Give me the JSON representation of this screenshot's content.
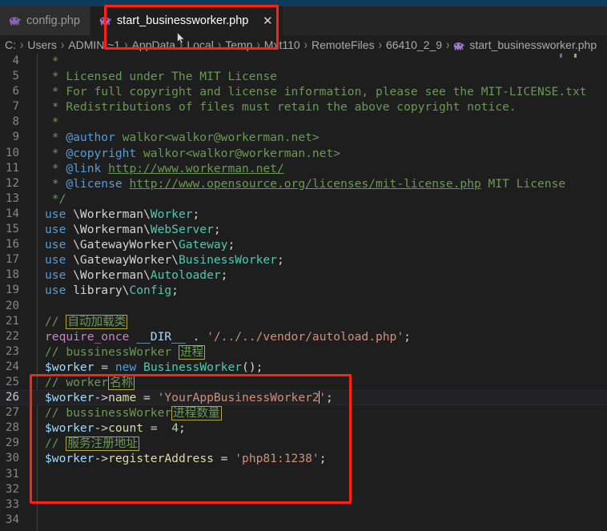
{
  "window": {
    "title_strip_color": "#0c3b5e"
  },
  "tabs": {
    "items": [
      {
        "label": "config.php",
        "icon": "php-elephant-icon",
        "active": false,
        "closable": false
      },
      {
        "label": "start_businessworker.php",
        "icon": "php-elephant-icon",
        "active": true,
        "closable": true,
        "close_label": "✕"
      }
    ]
  },
  "breadcrumbs": {
    "items": [
      {
        "label": "C:",
        "icon": null
      },
      {
        "label": "Users",
        "icon": null
      },
      {
        "label": "ADMINI~1",
        "icon": null
      },
      {
        "label": "AppData",
        "icon": null
      },
      {
        "label": "Local",
        "icon": null
      },
      {
        "label": "Temp",
        "icon": null
      },
      {
        "label": "Mxt110",
        "icon": null
      },
      {
        "label": "RemoteFiles",
        "icon": null
      },
      {
        "label": "66410_2_9",
        "icon": null
      },
      {
        "label": "start_businessworker.php",
        "icon": "php-elephant-icon"
      }
    ],
    "separator": "›"
  },
  "editor": {
    "language": "php",
    "current_line": 26,
    "first_visible_line": 4,
    "last_visible_line": 34,
    "colors": {
      "background": "#1e1e1e",
      "comment": "#6a9955",
      "keyword": "#569cd6",
      "type": "#4ec9b0",
      "string": "#ce9178",
      "variable": "#9cdcfe",
      "property": "#dcdcaa",
      "number": "#b5cea8",
      "function": "#c586c0",
      "linenumber": "#868686",
      "cjk_box_border": "#b5a642"
    },
    "lines": [
      {
        "n": 4,
        "text": " *"
      },
      {
        "n": 5,
        "text": " * Licensed under The MIT License"
      },
      {
        "n": 6,
        "text": " * For full copyright and license information, please see the MIT-LICENSE.txt"
      },
      {
        "n": 7,
        "text": " * Redistributions of files must retain the above copyright notice."
      },
      {
        "n": 8,
        "text": " *"
      },
      {
        "n": 9,
        "text": " * @author walkor<walkor@workerman.net>"
      },
      {
        "n": 10,
        "text": " * @copyright walkor<walkor@workerman.net>"
      },
      {
        "n": 11,
        "text": " * @link http://www.workerman.net/"
      },
      {
        "n": 12,
        "text": " * @license http://www.opensource.org/licenses/mit-license.php MIT License"
      },
      {
        "n": 13,
        "text": " */"
      },
      {
        "n": 14,
        "text": "use \\Workerman\\Worker;"
      },
      {
        "n": 15,
        "text": "use \\Workerman\\WebServer;"
      },
      {
        "n": 16,
        "text": "use \\GatewayWorker\\Gateway;"
      },
      {
        "n": 17,
        "text": "use \\GatewayWorker\\BusinessWorker;"
      },
      {
        "n": 18,
        "text": "use \\Workerman\\Autoloader;"
      },
      {
        "n": 19,
        "text": "use library\\Config;"
      },
      {
        "n": 20,
        "text": ""
      },
      {
        "n": 21,
        "text": "// 自动加载类"
      },
      {
        "n": 22,
        "text": "require_once __DIR__ . '/../../vendor/autoload.php';"
      },
      {
        "n": 23,
        "text": "// bussinessWorker 进程"
      },
      {
        "n": 24,
        "text": "$worker = new BusinessWorker();"
      },
      {
        "n": 25,
        "text": "// worker名称"
      },
      {
        "n": 26,
        "text": "$worker->name = 'YourAppBusinessWorker2';"
      },
      {
        "n": 27,
        "text": "// bussinessWorker进程数量"
      },
      {
        "n": 28,
        "text": "$worker->count =  4;"
      },
      {
        "n": 29,
        "text": "// 服务注册地址"
      },
      {
        "n": 30,
        "text": "$worker->registerAddress = 'php81:1238';"
      },
      {
        "n": 31,
        "text": ""
      },
      {
        "n": 32,
        "text": ""
      },
      {
        "n": 33,
        "text": ""
      },
      {
        "n": 34,
        "text": ""
      }
    ],
    "cjk_terms": [
      "自动加载类",
      "进程",
      "名称",
      "进程数量",
      "服务注册地址"
    ]
  },
  "annotations": {
    "boxes": [
      {
        "name": "tab-highlight",
        "color": "#ff2211"
      },
      {
        "name": "code-block-highlight",
        "color": "#ff2211"
      }
    ]
  }
}
